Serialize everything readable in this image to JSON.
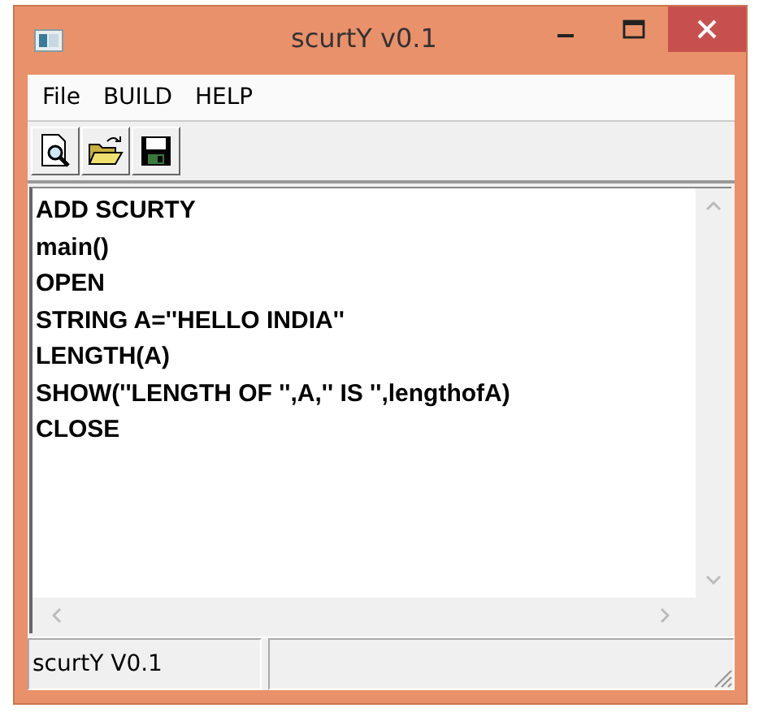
{
  "window": {
    "title": "scurtY v0.1"
  },
  "menu": [
    {
      "label": "File"
    },
    {
      "label": "BUILD"
    },
    {
      "label": "HELP"
    }
  ],
  "toolbar": [
    {
      "kind": "preview"
    },
    {
      "kind": "open"
    },
    {
      "kind": "save"
    }
  ],
  "editor": {
    "lines": [
      "ADD SCURTY",
      "main()",
      "OPEN",
      "STRING A=''HELLO INDIA''",
      "LENGTH(A)",
      "SHOW(''LENGTH OF '',A,'' IS '',lengthofA)",
      "CLOSE"
    ]
  },
  "status_bar": {
    "text": "scurtY V0.1"
  }
}
